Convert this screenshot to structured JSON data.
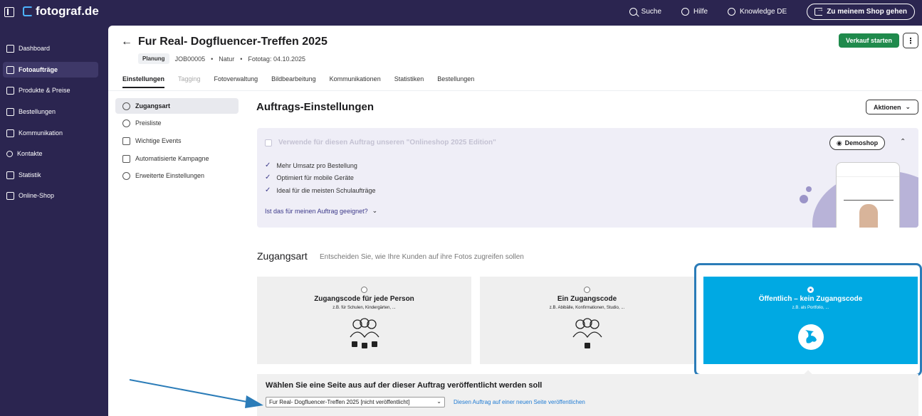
{
  "topbar": {
    "brand": "fotograf.de",
    "links": [
      {
        "label": "Suche",
        "icon": "search-icon"
      },
      {
        "label": "Hilfe",
        "icon": "info-icon"
      },
      {
        "label": "Knowledge DE",
        "icon": "knowledge-icon"
      }
    ],
    "shop_button": "Zu meinem Shop gehen"
  },
  "sidebar": {
    "items": [
      {
        "label": "Dashboard",
        "icon": "home-icon"
      },
      {
        "label": "Fotoaufträge",
        "icon": "image-icon",
        "active": true
      },
      {
        "label": "Produkte & Preise",
        "icon": "cart-icon"
      },
      {
        "label": "Bestellungen",
        "icon": "inbox-icon"
      },
      {
        "label": "Kommunikation",
        "icon": "message-icon"
      },
      {
        "label": "Kontakte",
        "icon": "user-icon"
      },
      {
        "label": "Statistik",
        "icon": "chart-icon"
      },
      {
        "label": "Online-Shop",
        "icon": "store-icon"
      }
    ]
  },
  "header": {
    "title": "Fur Real- Dogfluencer-Treffen 2025",
    "status": "Planung",
    "job_id": "JOB00005",
    "category": "Natur",
    "shoot_date": "Fototag: 04.10.2025",
    "start_button": "Verkauf starten",
    "more_button": "⋮"
  },
  "tabs": [
    {
      "label": "Einstellungen",
      "state": "active"
    },
    {
      "label": "Tagging",
      "state": "disabled"
    },
    {
      "label": "Fotoverwaltung",
      "state": "normal"
    },
    {
      "label": "Bildbearbeitung",
      "state": "normal"
    },
    {
      "label": "Kommunikationen",
      "state": "normal"
    },
    {
      "label": "Statistiken",
      "state": "normal"
    },
    {
      "label": "Bestellungen",
      "state": "normal"
    }
  ],
  "settings_nav": [
    {
      "label": "Zugangsart",
      "active": true
    },
    {
      "label": "Preisliste"
    },
    {
      "label": "Wichtige Events"
    },
    {
      "label": "Automatisierte Kampagne"
    },
    {
      "label": "Erweiterte Einstellungen"
    }
  ],
  "settings": {
    "title": "Auftrags-Einstellungen",
    "actions_button": "Aktionen"
  },
  "promo": {
    "headline": "Verwende für diesen Auftrag unseren \"Onlineshop 2025 Edition\"",
    "demoshop_button": "Demoshop",
    "features": [
      "Mehr Umsatz pro Bestellung",
      "Optimiert für mobile Geräte",
      "Ideal für die meisten Schulaufträge"
    ],
    "suitable_link": "Ist das für meinen Auftrag geeignet?"
  },
  "access": {
    "title": "Zugangsart",
    "subtitle": "Entscheiden Sie, wie Ihre Kunden auf ihre Fotos zugreifen sollen",
    "cards": [
      {
        "title": "Zugangscode für jede Person",
        "subtitle": "z.B. für Schulen, Kindergärten, ...",
        "selected": false
      },
      {
        "title": "Ein Zugangscode",
        "subtitle": "z.B. Abibälle, Konfirmationen, Studio, ...",
        "selected": false
      },
      {
        "title": "Öffentlich – kein Zugangscode",
        "subtitle": "z.B. als Portfolio, ...",
        "selected": true
      }
    ]
  },
  "page_select": {
    "title": "Wählen Sie eine Seite aus auf der dieser Auftrag veröffentlicht werden soll",
    "selected": "Fur Real- Dogfluencer-Treffen 2025 [nicht veröffentlicht]",
    "link": "Diesen Auftrag auf einer neuen Seite veröffentlichen"
  },
  "colors": {
    "sidebar_bg": "#2b2550",
    "primary_green": "#1f8a4c",
    "selected_card": "#00a9e3",
    "highlight_frame": "#2b7cb8",
    "annotation_arrow": "#2b7cb8"
  }
}
